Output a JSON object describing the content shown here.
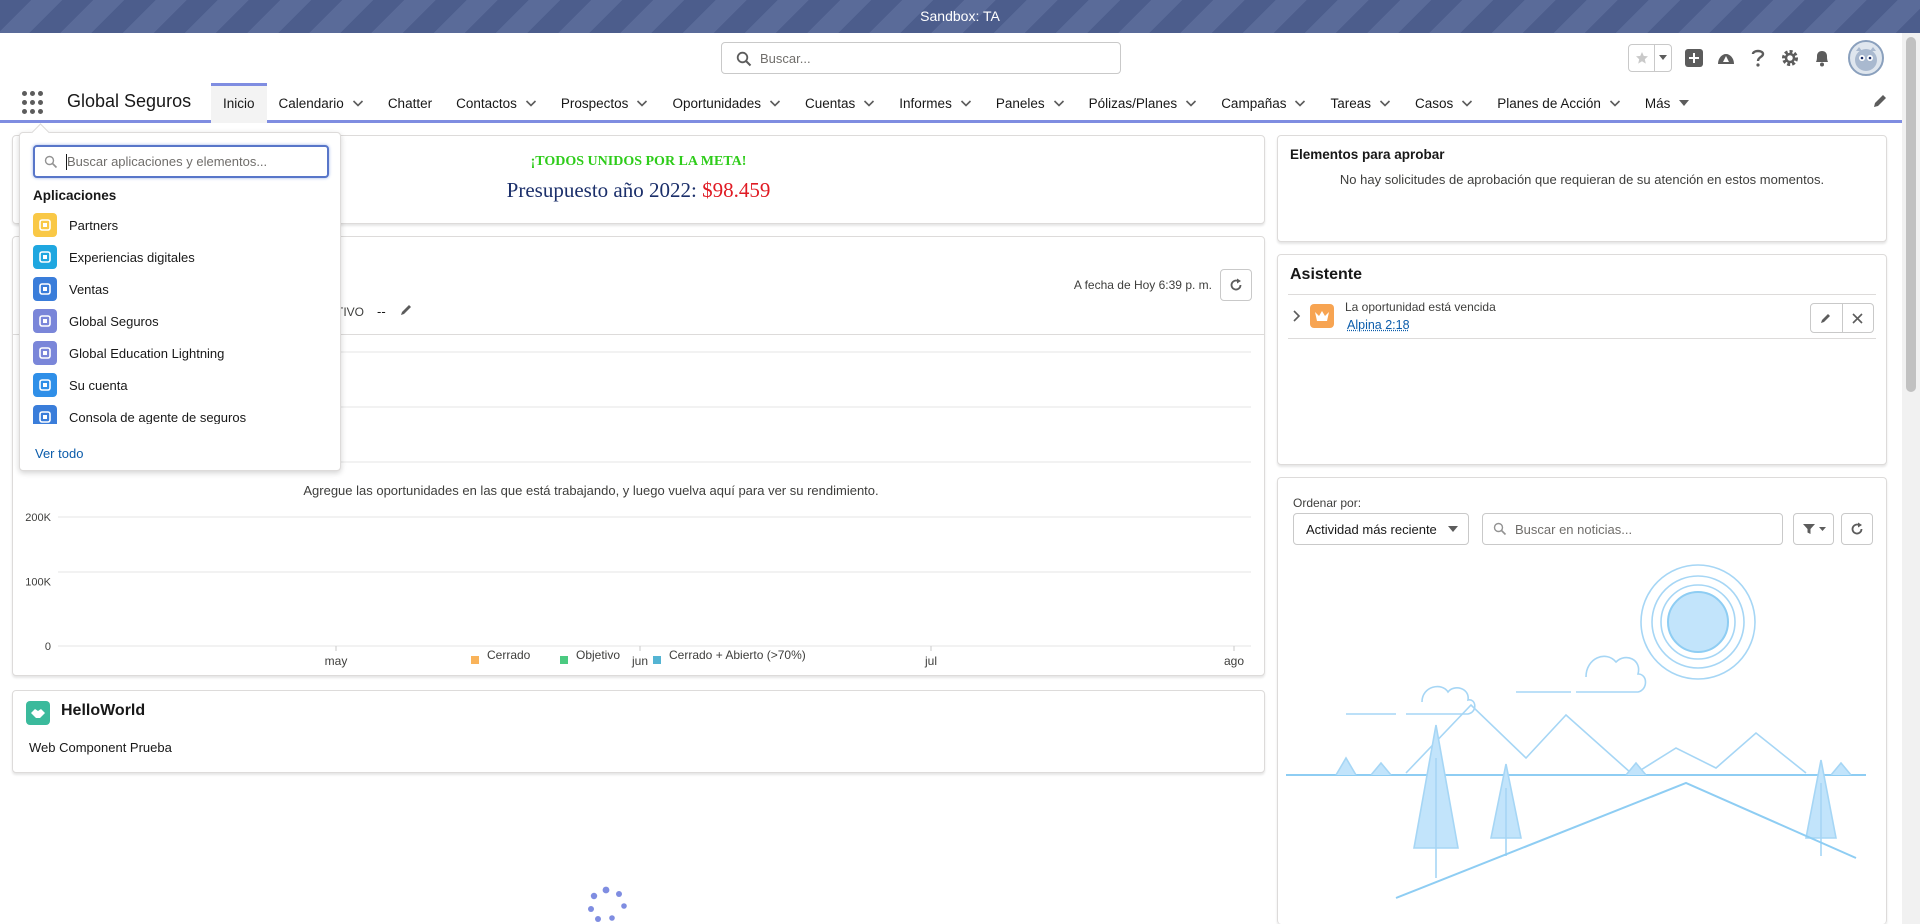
{
  "sandbox": {
    "label": "Sandbox: TA"
  },
  "header": {
    "search_placeholder": "Buscar..."
  },
  "nav": {
    "app_name": "Global Seguros",
    "items": [
      {
        "label": "Inicio",
        "active": true,
        "dropdown": false
      },
      {
        "label": "Calendario",
        "dropdown": true
      },
      {
        "label": "Chatter",
        "dropdown": false
      },
      {
        "label": "Contactos",
        "dropdown": true
      },
      {
        "label": "Prospectos",
        "dropdown": true
      },
      {
        "label": "Oportunidades",
        "dropdown": true
      },
      {
        "label": "Cuentas",
        "dropdown": true
      },
      {
        "label": "Informes",
        "dropdown": true
      },
      {
        "label": "Paneles",
        "dropdown": true
      },
      {
        "label": "Pólizas/Planes",
        "dropdown": true
      },
      {
        "label": "Campañas",
        "dropdown": true
      },
      {
        "label": "Tareas",
        "dropdown": true
      },
      {
        "label": "Casos",
        "dropdown": true
      },
      {
        "label": "Planes de Acción",
        "dropdown": true
      },
      {
        "label": "Más",
        "dropdown": true
      }
    ]
  },
  "launcher": {
    "search_placeholder": "Buscar aplicaciones y elementos...",
    "heading": "Aplicaciones",
    "apps": [
      {
        "label": "Partners",
        "color": "#f9c846"
      },
      {
        "label": "Experiencias digitales",
        "color": "#1fa7e0"
      },
      {
        "label": "Ventas",
        "color": "#3a7dda"
      },
      {
        "label": "Global Seguros",
        "color": "#7a86d9"
      },
      {
        "label": "Global Education Lightning",
        "color": "#7a86d9"
      },
      {
        "label": "Su cuenta",
        "color": "#2f8fe8"
      },
      {
        "label": "Consola de agente de seguros",
        "color": "#3a7dda"
      }
    ],
    "view_all": "Ver todo"
  },
  "banner": {
    "line1": "¡TODOS UNIDOS POR LA META!",
    "line2_prefix": "Presupuesto año 2022:",
    "amount": "$98.459"
  },
  "performance": {
    "as_of": "A fecha de Hoy 6:39 p. m.",
    "objective_label": "TIVO",
    "objective_value": "--",
    "empty_message": "Agregue las oportunidades en las que está trabajando, y luego vuelva aquí para ver su rendimiento."
  },
  "chart_data": {
    "type": "line",
    "x": [
      "may",
      "jun",
      "jul",
      "ago"
    ],
    "y_ticks": [
      "0",
      "100K",
      "200K"
    ],
    "ylim": [
      0,
      200000
    ],
    "series": [
      {
        "name": "Cerrado",
        "color": "#f9b35a",
        "values": []
      },
      {
        "name": "Objetivo",
        "color": "#4bca81",
        "values": []
      },
      {
        "name": "Cerrado + Abierto (>70%)",
        "color": "#54b4d3",
        "values": []
      }
    ],
    "grid": true,
    "legend": "bottom"
  },
  "hello": {
    "title": "HelloWorld",
    "body": "Web Component Prueba"
  },
  "approvals": {
    "title": "Elementos para aprobar",
    "message": "No hay solicitudes de aprobación que requieran de su atención en estos momentos."
  },
  "assistant": {
    "title": "Asistente",
    "item_text": "La oportunidad está vencida",
    "item_link": "Alpina 2:18"
  },
  "feed": {
    "sort_label": "Ordenar por:",
    "sort_value": "Actividad más reciente",
    "search_placeholder": "Buscar en noticias..."
  }
}
